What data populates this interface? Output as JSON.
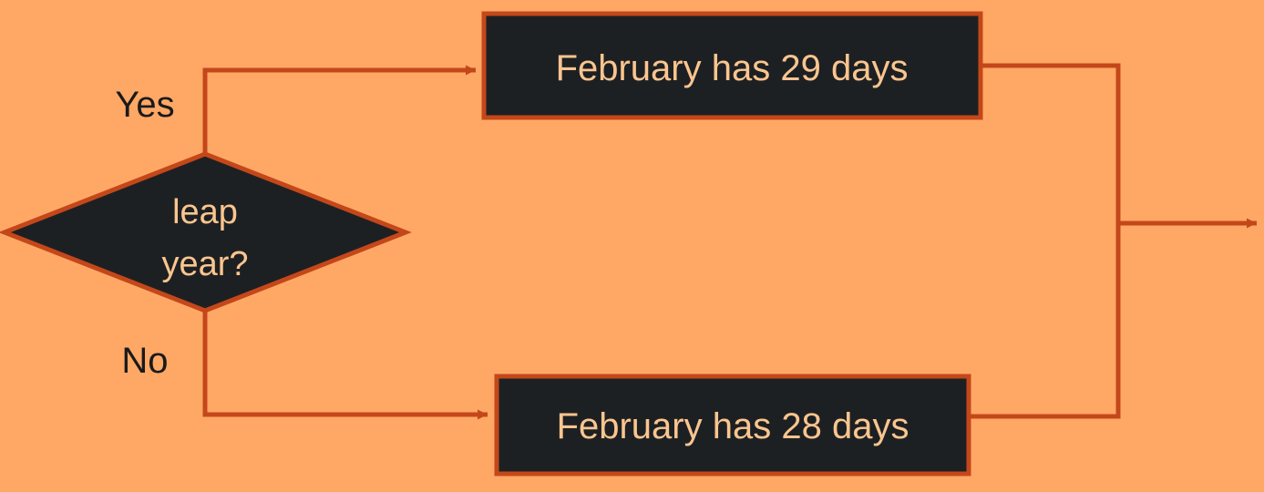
{
  "colors": {
    "background": "#FFA866",
    "line": "#C4471A",
    "box_fill": "#1D2023",
    "box_text": "#FBC58F",
    "label_text": "#1A1A1A"
  },
  "decision": {
    "line1": "leap",
    "line2": "year?"
  },
  "branches": {
    "yes_label": "Yes",
    "no_label": "No"
  },
  "outcomes": {
    "leap": "February has 29 days",
    "common": "February has 28 days"
  }
}
